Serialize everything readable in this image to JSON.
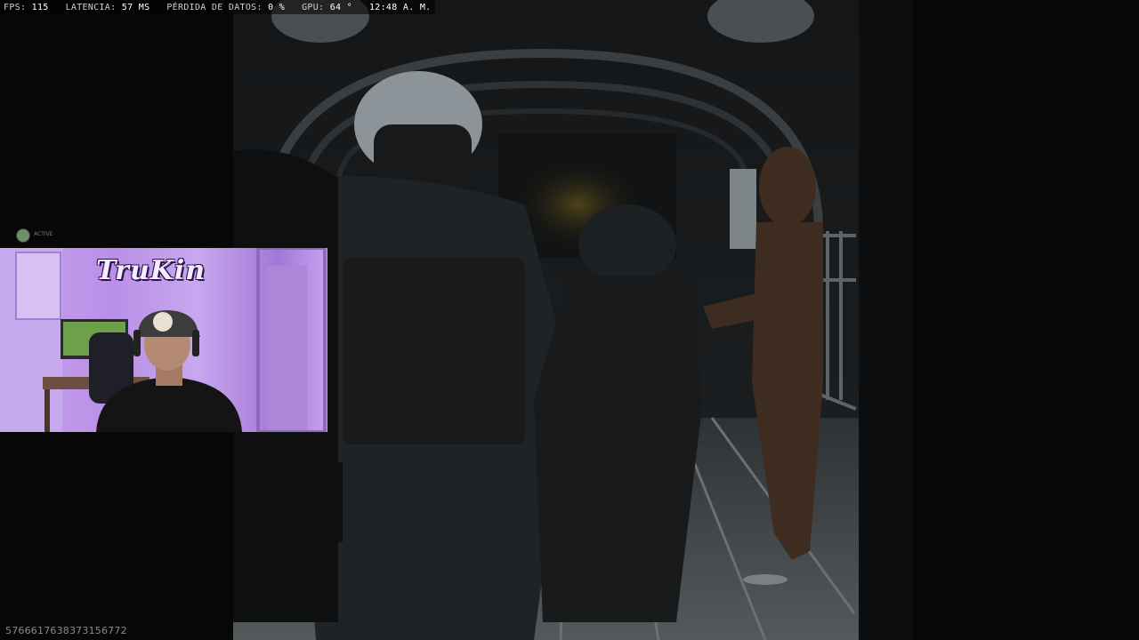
{
  "hud": {
    "fps_label": "FPS:",
    "fps_value": "115",
    "latency_label": "LATENCIA:",
    "latency_value": "57 MS",
    "packet_loss_label": "PÉRDIDA DE DATOS:",
    "packet_loss_value": "0 %",
    "gpu_label": "GPU:",
    "gpu_value": "64 °",
    "clock": "12:48 A. M."
  },
  "webcam": {
    "logo_text": "TruKin"
  },
  "overlay": {
    "small_avatar_label": "ACTIVE",
    "stream_id": "576661763837315677​2"
  }
}
